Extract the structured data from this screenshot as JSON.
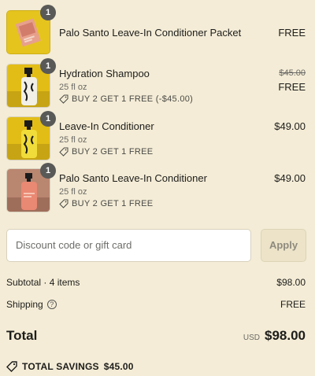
{
  "colors": {
    "background": "#f4ecd6",
    "badge": "#595957",
    "thumb_yellow": "#e9c61c",
    "thumb_rose": "#b88670"
  },
  "items": [
    {
      "name": "Palo Santo Leave-In Conditioner Packet",
      "qty": "1",
      "price": "FREE",
      "variant": "",
      "promo": "",
      "original_price": "",
      "image": "packet"
    },
    {
      "name": "Hydration Shampoo",
      "qty": "1",
      "variant": "25 fl oz",
      "promo": "BUY 2 GET 1 FREE (-$45.00)",
      "original_price": "$45.00",
      "price": "FREE",
      "image": "shampoo-bottle"
    },
    {
      "name": "Leave-In Conditioner",
      "qty": "1",
      "variant": "25 fl oz",
      "promo": "BUY 2 GET 1 FREE",
      "original_price": "",
      "price": "$49.00",
      "image": "conditioner-bottle"
    },
    {
      "name": "Palo Santo Leave-In Conditioner",
      "qty": "1",
      "variant": "25 fl oz",
      "promo": "BUY 2 GET 1 FREE",
      "original_price": "",
      "price": "$49.00",
      "image": "palo-santo-bottle"
    }
  ],
  "discount": {
    "placeholder": "Discount code or gift card",
    "apply_label": "Apply"
  },
  "summary": {
    "subtotal_label": "Subtotal · 4 items",
    "subtotal_value": "$98.00",
    "shipping_label": "Shipping",
    "shipping_help": "?",
    "shipping_value": "FREE",
    "total_label": "Total",
    "currency": "USD",
    "total_value": "$98.00",
    "savings_label": "TOTAL SAVINGS",
    "savings_value": "$45.00"
  }
}
